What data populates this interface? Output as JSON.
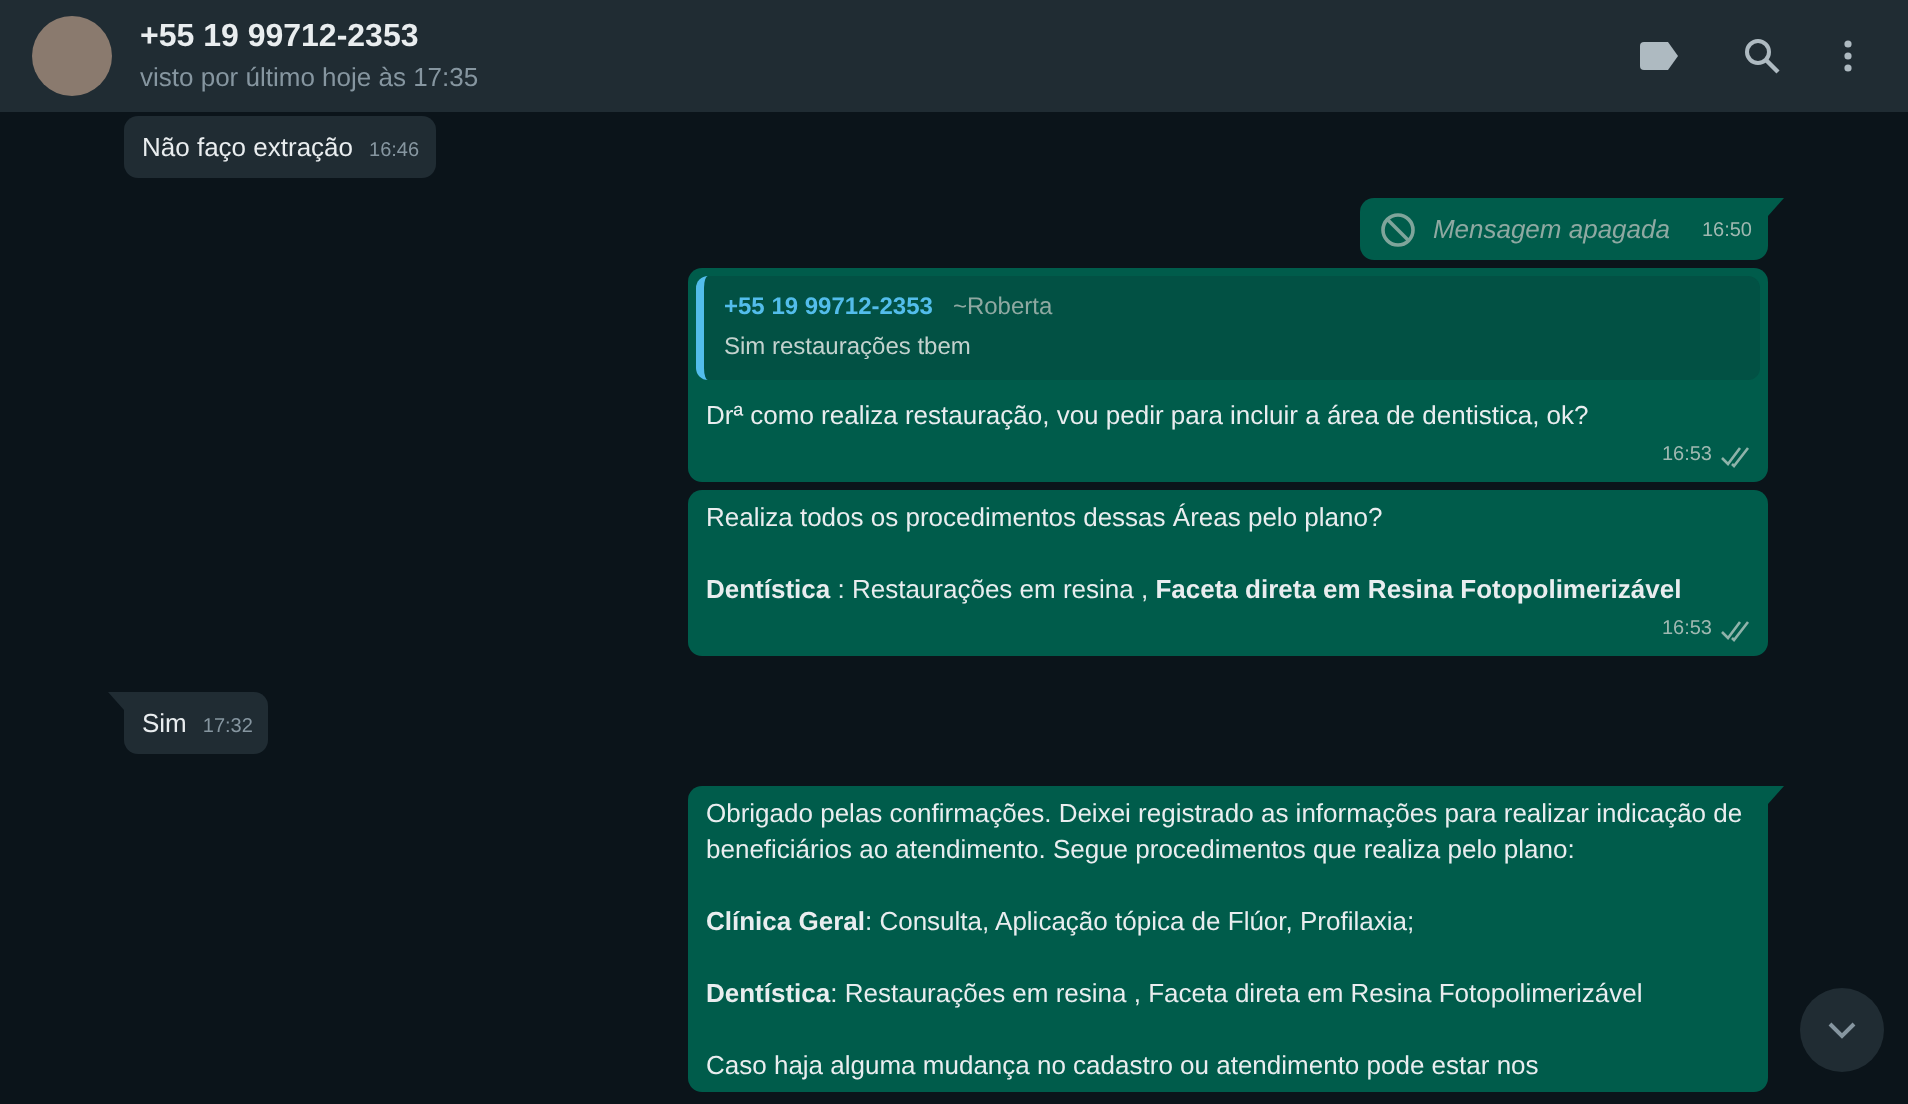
{
  "header": {
    "name": "+55 19 99712-2353",
    "status": "visto por último hoje às 17:35"
  },
  "messages": [
    {
      "kind": "in",
      "tail": false,
      "paragraphs": [
        "Não faço extração"
      ],
      "time": "16:46",
      "read": false
    },
    {
      "kind": "deleted",
      "tail": true,
      "paragraphs": [
        "Mensagem apagada"
      ],
      "time": "16:50",
      "read": false
    },
    {
      "kind": "out",
      "tail": false,
      "quote": {
        "author": "+55 19 99712-2353",
        "alias": "~Roberta",
        "text": "Sim restaurações tbem"
      },
      "paragraphs": [
        "Drª como realiza restauração, vou pedir para incluir a área de dentistica, ok?"
      ],
      "time": "16:53",
      "read": true
    },
    {
      "kind": "out",
      "tail": false,
      "paragraphs": [
        "Realiza todos os procedimentos dessas Áreas pelo plano?",
        "**Dentística** : Restaurações em resina , **Faceta direta em Resina Fotopolimerizável**"
      ],
      "time": "16:53",
      "read": true
    },
    {
      "kind": "in",
      "tail": true,
      "paragraphs": [
        "Sim"
      ],
      "time": "17:32",
      "read": false
    },
    {
      "kind": "out",
      "tail": true,
      "paragraphs": [
        "Obrigado pelas confirmações. Deixei registrado as informações para realizar indicação de beneficiários ao atendimento. Segue procedimentos que realiza pelo plano:",
        "**Clínica Geral**: Consulta, Aplicação tópica de Flúor, Profilaxia;",
        "**Dentística**: Restaurações em resina , Faceta direta em Resina Fotopolimerizável",
        "Caso haja alguma mudança no cadastro ou atendimento pode estar nos"
      ]
    }
  ]
}
